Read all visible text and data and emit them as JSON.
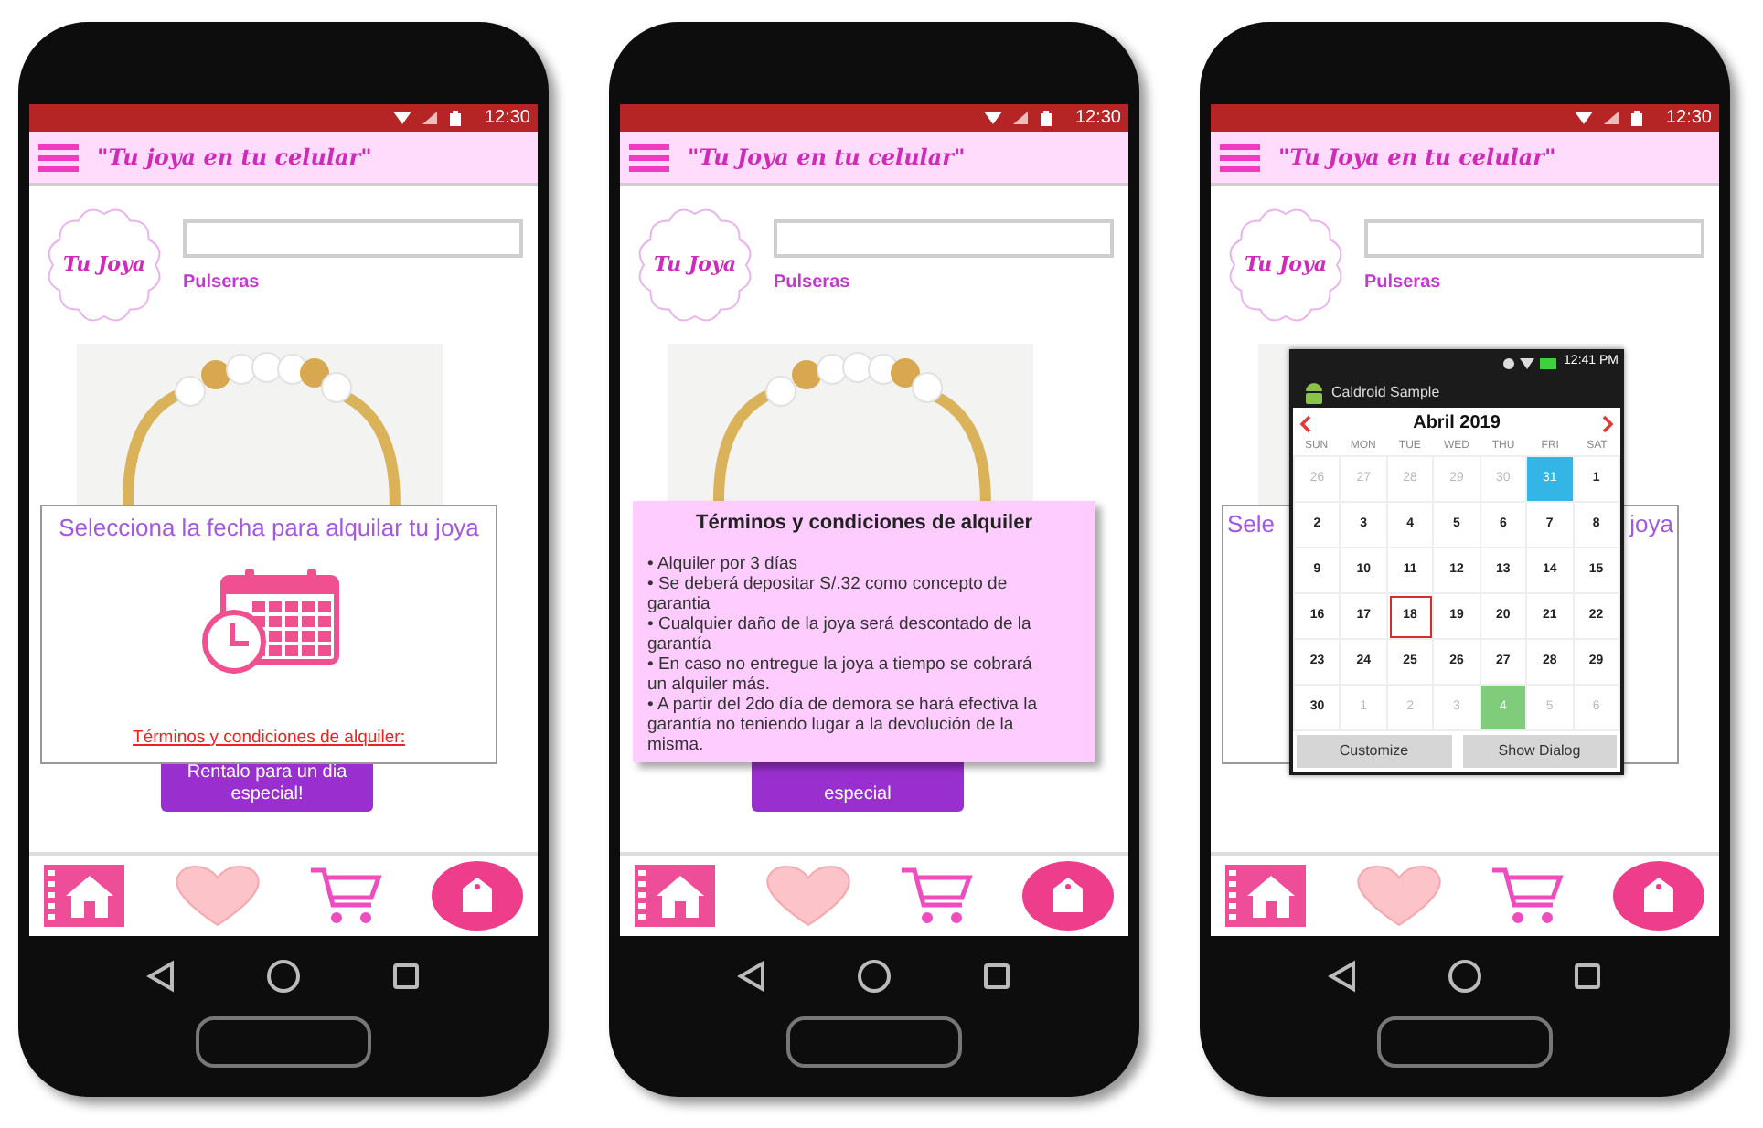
{
  "phones": [
    {
      "status_time": "12:30",
      "app_title": "\"Tu joya en tu celular\"",
      "logo": "Tu Joya",
      "category": "Pulseras",
      "button": "Rentalo para un dia especial!",
      "date_dialog": {
        "title": "Selecciona la fecha para alquilar tu joya",
        "link": "Términos y condiciones de alquiler:"
      }
    },
    {
      "status_time": "12:30",
      "app_title": "\"Tu Joya en tu celular\"",
      "logo": "Tu Joya",
      "category": "Pulseras",
      "button": "especial",
      "terms": {
        "title": "Términos y condiciones de alquiler",
        "items": [
          "• Alquiler por 3 días",
          "• Se deberá depositar S/.32 como concepto de garantia",
          "• Cualquier daño de la joya será descontado de la garantía",
          "• En caso no entregue la joya a tiempo se cobrará un alquiler más.",
          "• A partir del 2do día de demora se hará efectiva la garantía no teniendo lugar a la devolución de la misma."
        ]
      }
    },
    {
      "status_time": "12:30",
      "app_title": "\"Tu Joya en tu celular\"",
      "logo": "Tu Joya",
      "category": "Pulseras",
      "date_dialog_parts": [
        "Sele",
        "joya"
      ],
      "calendar_app": {
        "status_time": "12:41 PM",
        "title": "Caldroid Sample",
        "month": "Abril 2019",
        "weekdays": [
          "SUN",
          "MON",
          "TUE",
          "WED",
          "THU",
          "FRI",
          "SAT"
        ],
        "days": [
          {
            "label": "26",
            "kind": "muted"
          },
          {
            "label": "27",
            "kind": "muted"
          },
          {
            "label": "28",
            "kind": "muted"
          },
          {
            "label": "29",
            "kind": "muted"
          },
          {
            "label": "30",
            "kind": "muted"
          },
          {
            "label": "31",
            "kind": "muted",
            "color": "#33b5e5"
          },
          {
            "label": "1",
            "kind": "normal"
          },
          {
            "label": "2",
            "kind": "normal"
          },
          {
            "label": "3",
            "kind": "normal"
          },
          {
            "label": "4",
            "kind": "normal"
          },
          {
            "label": "5",
            "kind": "normal"
          },
          {
            "label": "6",
            "kind": "normal"
          },
          {
            "label": "7",
            "kind": "normal"
          },
          {
            "label": "8",
            "kind": "normal"
          },
          {
            "label": "9",
            "kind": "normal"
          },
          {
            "label": "10",
            "kind": "normal"
          },
          {
            "label": "11",
            "kind": "normal"
          },
          {
            "label": "12",
            "kind": "normal"
          },
          {
            "label": "13",
            "kind": "normal"
          },
          {
            "label": "14",
            "kind": "normal"
          },
          {
            "label": "15",
            "kind": "normal"
          },
          {
            "label": "16",
            "kind": "normal"
          },
          {
            "label": "17",
            "kind": "normal"
          },
          {
            "label": "18",
            "kind": "today"
          },
          {
            "label": "19",
            "kind": "normal"
          },
          {
            "label": "20",
            "kind": "normal"
          },
          {
            "label": "21",
            "kind": "normal"
          },
          {
            "label": "22",
            "kind": "normal"
          },
          {
            "label": "23",
            "kind": "normal"
          },
          {
            "label": "24",
            "kind": "normal"
          },
          {
            "label": "25",
            "kind": "normal"
          },
          {
            "label": "26",
            "kind": "normal"
          },
          {
            "label": "27",
            "kind": "normal"
          },
          {
            "label": "28",
            "kind": "normal"
          },
          {
            "label": "29",
            "kind": "normal"
          },
          {
            "label": "30",
            "kind": "normal"
          },
          {
            "label": "1",
            "kind": "muted"
          },
          {
            "label": "2",
            "kind": "muted"
          },
          {
            "label": "3",
            "kind": "muted"
          },
          {
            "label": "4",
            "kind": "muted",
            "color": "#7fcc7a"
          },
          {
            "label": "5",
            "kind": "muted"
          },
          {
            "label": "6",
            "kind": "muted"
          }
        ],
        "buttons": [
          "Customize",
          "Show Dialog"
        ]
      }
    }
  ]
}
